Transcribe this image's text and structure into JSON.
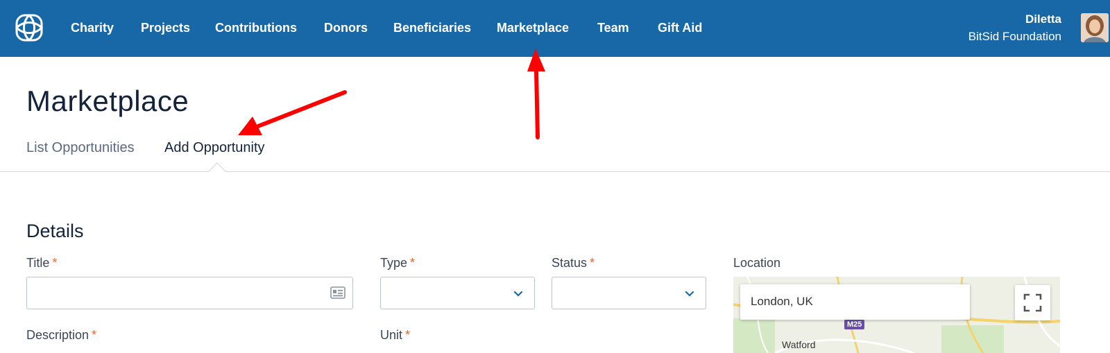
{
  "nav": {
    "items": [
      "Charity",
      "Projects",
      "Contributions",
      "Donors",
      "Beneficiaries",
      "Marketplace",
      "Team",
      "Gift Aid"
    ]
  },
  "user": {
    "name": "Diletta",
    "org": "BitSid Foundation"
  },
  "page": {
    "title": "Marketplace",
    "tabs": [
      {
        "label": "List Opportunities",
        "active": false
      },
      {
        "label": "Add Opportunity",
        "active": true
      }
    ]
  },
  "form": {
    "section_title": "Details",
    "title_label": "Title",
    "type_label": "Type",
    "status_label": "Status",
    "location_label": "Location",
    "description_label": "Description",
    "unit_label": "Unit",
    "required_mark": "*",
    "title_value": "",
    "type_value": "",
    "status_value": ""
  },
  "map": {
    "search_value": "London, UK",
    "road_badge": "M25",
    "place_labels": [
      "Watford"
    ]
  },
  "colors": {
    "nav_bg": "#1868a8",
    "required": "#e4672f",
    "annotation_arrow": "#ff0000"
  },
  "icons": [
    "logo-icon",
    "id-card-icon",
    "chevron-down-icon",
    "fullscreen-icon"
  ]
}
